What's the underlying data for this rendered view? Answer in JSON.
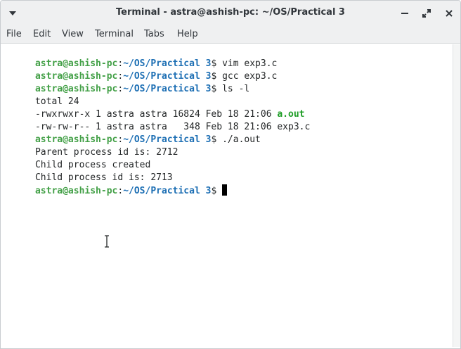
{
  "window": {
    "title": "Terminal - astra@ashish-pc: ~/OS/Practical 3",
    "icons": {
      "menu": "chevron-down-icon",
      "minimize": "minimize-icon",
      "maximize": "maximize-icon",
      "close": "close-icon"
    }
  },
  "menubar": {
    "items": [
      "File",
      "Edit",
      "View",
      "Terminal",
      "Tabs",
      "Help"
    ]
  },
  "terminal": {
    "prompt": {
      "user_host": "astra@ashish-pc",
      "separator": ":",
      "path": "~/OS/Practical 3",
      "suffix": "$ "
    },
    "lines": [
      {
        "type": "prompt",
        "command": "vim exp3.c"
      },
      {
        "type": "prompt",
        "command": "gcc exp3.c"
      },
      {
        "type": "prompt",
        "command": "ls -l"
      },
      {
        "type": "output",
        "text": "total 24"
      },
      {
        "type": "ls",
        "text": "-rwxrwxr-x 1 astra astra 16824 Feb 18 21:06 ",
        "file": "a.out"
      },
      {
        "type": "output",
        "text": "-rw-rw-r-- 1 astra astra   348 Feb 18 21:06 exp3.c"
      },
      {
        "type": "prompt",
        "command": "./a.out"
      },
      {
        "type": "output",
        "text": "Parent process id is: 2712"
      },
      {
        "type": "output",
        "text": "Child process created"
      },
      {
        "type": "output",
        "text": "Child process id is: 2713"
      },
      {
        "type": "prompt",
        "command": ""
      }
    ],
    "colors": {
      "user_host": "#43a047",
      "path": "#1d6fb4",
      "executable": "#1e9d26",
      "text": "#232627"
    }
  }
}
